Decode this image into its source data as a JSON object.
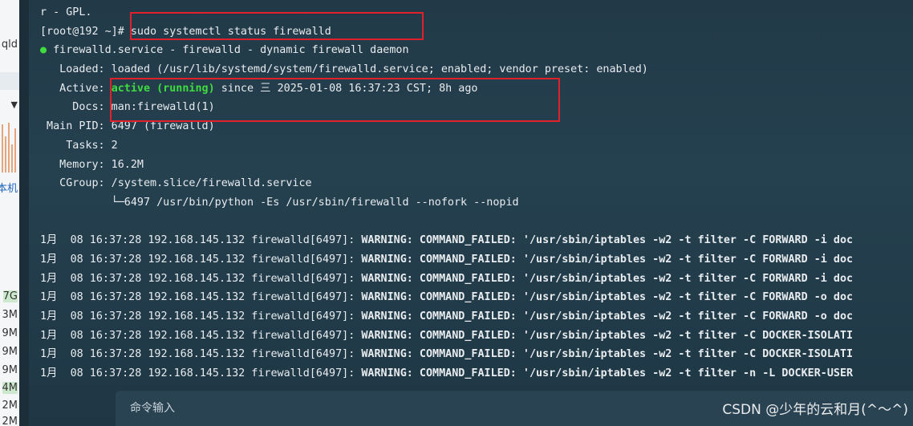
{
  "sidebar": {
    "texts": [
      "qld",
      "本机",
      "7G",
      "3M",
      "9M",
      "9M",
      "9M",
      "4M",
      "2M",
      "2M"
    ],
    "dropdown_glyph": "▼"
  },
  "terminal": {
    "line0": "r - GPL.",
    "prompt": "[root@192 ~]# ",
    "command": "sudo systemctl status firewalld",
    "service_dot": "●",
    "service_title": " firewalld.service - firewalld - dynamic firewall daemon",
    "loaded": "   Loaded: loaded (/usr/lib/systemd/system/firewalld.service; enabled; vendor preset: enabled)",
    "active_label": "   Active: ",
    "active_state": "active (running)",
    "active_since": " since 三 2025-01-08 16:37:23 CST; 8h ago",
    "docs": "     Docs: man:firewalld(1)",
    "mainpid": " Main PID: 6497 (firewalld)",
    "tasks": "    Tasks: 2",
    "memory": "   Memory: 16.2M",
    "cgroup": "   CGroup: /system.slice/firewalld.service",
    "cgroup_child": "           └─6497 /usr/bin/python -Es /usr/sbin/firewalld --nofork --nopid",
    "log_prefix": "1月  08 16:37:28 192.168.145.132 firewalld[6497]: ",
    "log_tag": "WARNING: COMMAND_FAILED: '/usr/sbin/iptables -w2 -t filter ",
    "log_suffixes": [
      "-C FORWARD -i doc",
      "-C FORWARD -i doc",
      "-C FORWARD -i doc",
      "-C FORWARD -o doc",
      "-C FORWARD -o doc",
      "-C DOCKER-ISOLATI",
      "-C DOCKER-ISOLATI",
      "-n -L DOCKER-USER"
    ]
  },
  "cmdbar": {
    "placeholder": "命令输入"
  },
  "watermark": "CSDN @少年的云和月(^～^)",
  "colors": {
    "highlight_box": "#e0202a",
    "active_green": "#3fdc3f",
    "background": "#223a48"
  }
}
